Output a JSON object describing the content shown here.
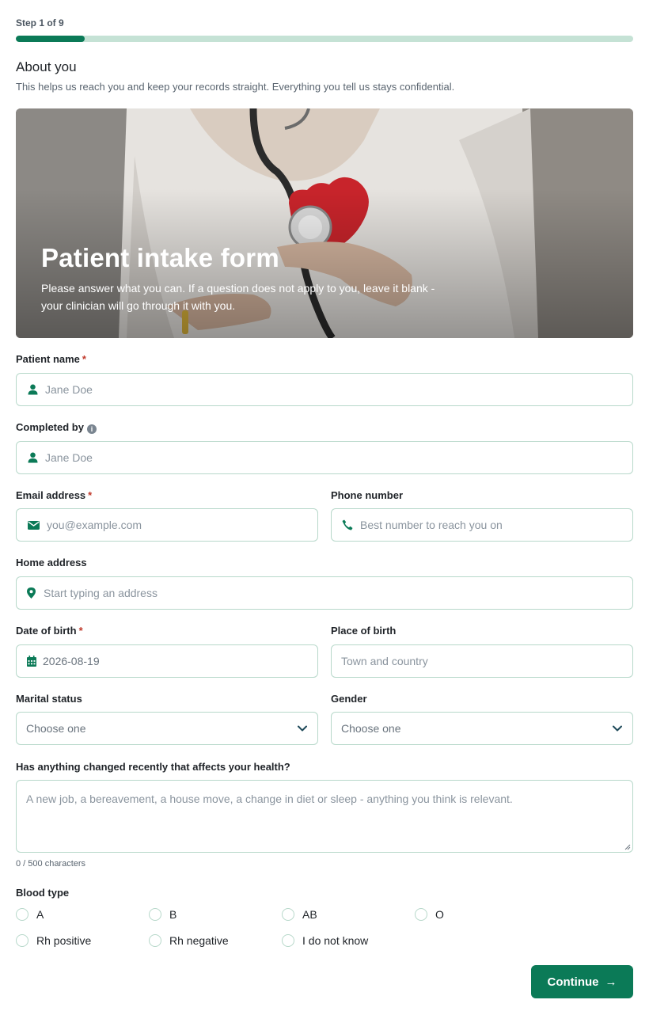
{
  "progress": {
    "step_label": "Step 1 of 9",
    "fraction": 0.111
  },
  "section": {
    "title": "About you",
    "description": "This helps us reach you and keep your records straight. Everything you tell us stays confidential."
  },
  "hero": {
    "title": "Patient intake form",
    "subtitle": "Please answer what you can. If a question does not apply to you, leave it blank - your clinician will go through it with you."
  },
  "fields": {
    "patient_name": {
      "label": "Patient name",
      "required": "*",
      "placeholder": "Jane Doe"
    },
    "completed_by": {
      "label": "Completed by",
      "placeholder": "Jane Doe"
    },
    "email": {
      "label": "Email address",
      "required": "*",
      "placeholder": "you@example.com"
    },
    "phone": {
      "label": "Phone number",
      "placeholder": "Best number to reach you on"
    },
    "home_address": {
      "label": "Home address",
      "placeholder": "Start typing an address"
    },
    "date_of_birth": {
      "label": "Date of birth",
      "required": "*",
      "value": "2026-08-19"
    },
    "place_of_birth": {
      "label": "Place of birth",
      "placeholder": "Town and country"
    },
    "marital_status": {
      "label": "Marital status",
      "selected": "Choose one"
    },
    "gender": {
      "label": "Gender",
      "selected": "Choose one"
    },
    "health_changes": {
      "label": "Has anything changed recently that affects your health?",
      "placeholder": "A new job, a bereavement, a house move, a change in diet or sleep - anything you think is relevant.",
      "char_count": "0 / 500 characters"
    }
  },
  "blood_type": {
    "label": "Blood type",
    "options": [
      "A",
      "B",
      "AB",
      "O",
      "Rh positive",
      "Rh negative",
      "I do not know"
    ]
  },
  "actions": {
    "continue_label": "Continue",
    "continue_arrow": "→"
  },
  "colors": {
    "accent": "#0b7a57",
    "border": "#b7d8ca",
    "required": "#c0392b"
  }
}
